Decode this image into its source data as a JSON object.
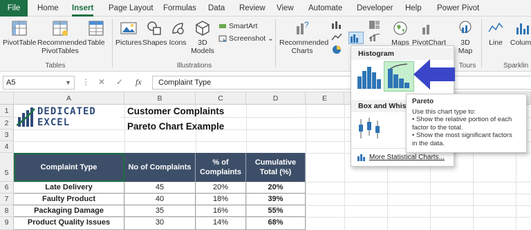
{
  "tabs": [
    "File",
    "Home",
    "Insert",
    "Page Layout",
    "Formulas",
    "Data",
    "Review",
    "View",
    "Automate",
    "Developer",
    "Help",
    "Power Pivot"
  ],
  "ribbon": {
    "pivottable": "PivotTable",
    "recommended_pivottables_1": "Recommended",
    "recommended_pivottables_2": "PivotTables",
    "table": "Table",
    "tables_group": "Tables",
    "pictures": "Pictures",
    "shapes": "Shapes",
    "icons": "Icons",
    "models_1": "3D",
    "models_2": "Models",
    "smartart": "SmartArt",
    "screenshot": "Screenshot",
    "illustrations_group": "Illustrations",
    "recommended_charts_1": "Recommended",
    "recommended_charts_2": "Charts",
    "maps": "Maps",
    "pivotchart": "PivotChart",
    "map_1": "3D",
    "map_2": "Map",
    "tours_group": "Tours",
    "line": "Line",
    "column": "Column",
    "sparklines_group": "Sparklin"
  },
  "formula_bar": {
    "name_box": "A5",
    "fx": "fx",
    "content": "Complaint Type"
  },
  "columns": [
    "A",
    "B",
    "C",
    "D",
    "E"
  ],
  "rows": [
    "1",
    "2",
    "3",
    "4",
    "5",
    "6",
    "7",
    "8",
    "9"
  ],
  "logo": {
    "line1": "DEDICATED",
    "line2": "EXCEL"
  },
  "title": {
    "line1": "Customer Complaints",
    "line2": "Pareto Chart Example"
  },
  "table": {
    "headers": [
      "Complaint Type",
      "No of Complaints",
      "% of Complaints",
      "Cumulative Total (%)"
    ],
    "header_c_1": "% of",
    "header_c_2": "Complaints",
    "header_d_1": "Cumulative",
    "header_d_2": "Total (%)",
    "rows": [
      [
        "Late Delivery",
        "45",
        "20%",
        "20%"
      ],
      [
        "Faulty Product",
        "40",
        "18%",
        "39%"
      ],
      [
        "Packaging Damage",
        "35",
        "16%",
        "55%"
      ],
      [
        "Product Quality Issues",
        "30",
        "14%",
        "68%"
      ]
    ]
  },
  "dropdown": {
    "histogram_header": "Histogram",
    "boxwhisker_header": "Box and Whisk",
    "more_link": "More Statistical Charts..."
  },
  "tooltip": {
    "title": "Pareto",
    "line1": "Use this chart type to:",
    "line2": "• Show the relative portion of each",
    "line3": "factor to the total.",
    "line4": "• Show the most significant factors",
    "line5": "in the data."
  },
  "colors": {
    "excel_green": "#1d6f42",
    "header_fill": "#3d4f68",
    "arrow": "#3a46c8",
    "chart_blue": "#2e75b6",
    "pareto_highlight": "#c6efce"
  }
}
